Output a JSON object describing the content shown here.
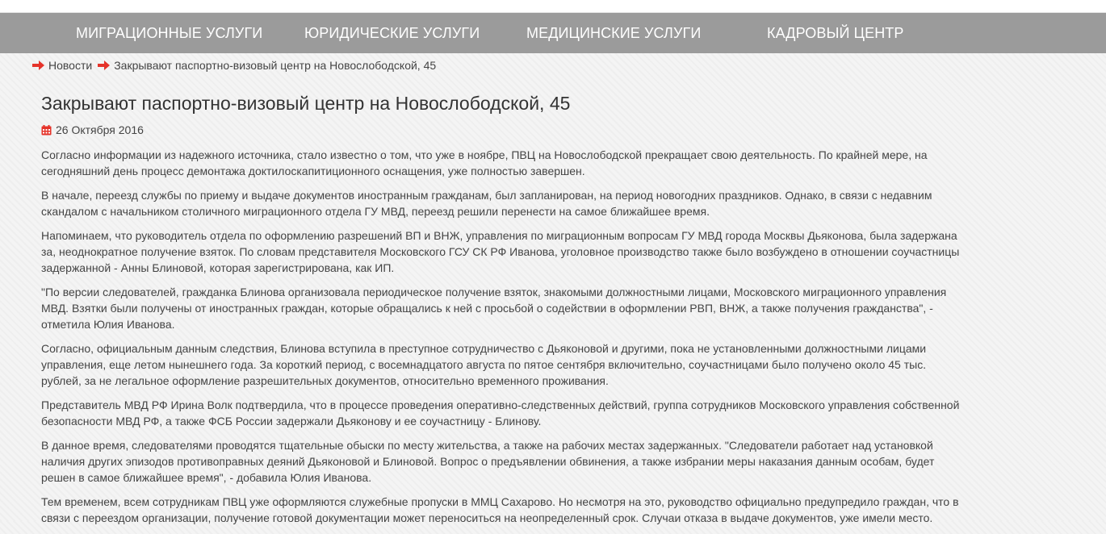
{
  "nav": {
    "items": [
      {
        "label": "МИГРАЦИОННЫЕ УСЛУГИ"
      },
      {
        "label": "ЮРИДИЧЕСКИЕ УСЛУГИ"
      },
      {
        "label": "МЕДИЦИНСКИЕ УСЛУГИ"
      },
      {
        "label": "КАДРОВЫЙ ЦЕНТР"
      }
    ]
  },
  "breadcrumb": {
    "items": [
      {
        "label": "Новости"
      },
      {
        "label": "Закрывают паспортно-визовый центр на Новослободской, 45"
      }
    ],
    "arrow_icon": "arrow-right-icon"
  },
  "article": {
    "title": "Закрывают паспортно-визовый центр на Новослободской, 45",
    "date": "26 Октября 2016",
    "date_icon": "calendar-icon",
    "paragraphs": [
      "Согласно информации из надежного источника, стало известно о том, что уже в ноябре, ПВЦ на Новослободской прекращает свою деятельность. По крайней мере, на сегодняшний день процесс демонтажа доктилоскапитиционного оснащения, уже полностью завершен.",
      "В начале, переезд службы по приему и выдаче документов иностранным гражданам, был запланирован, на период новогодних праздников. Однако, в связи с недавним скандалом с начальником столичного миграционного отдела ГУ МВД, переезд решили перенести на самое ближайшее время.",
      "Напоминаем, что руководитель отдела по оформлению разрешений ВП и ВНЖ, управления по миграционным вопросам ГУ МВД города Москвы Дьяконова, была задержана за, неоднократное получение взяток. По словам представителя Московского ГСУ СК РФ Иванова, уголовное производство также было возбуждено в отношении соучастницы задержанной - Анны Блиновой, которая зарегистрирована, как ИП.",
      "\"По версии следователей, гражданка Блинова организовала периодическое получение взяток, знакомыми должностными лицами, Московского миграционного управления МВД. Взятки были получены от иностранных граждан, которые обращались к ней с просьбой о содействии в оформлении РВП, ВНЖ, а также получения гражданства\", - отметила Юлия Иванова.",
      "Согласно, официальным данным следствия, Блинова вступила в преступное сотрудничество с Дьяконовой и другими, пока не установленными должностными лицами управления, еще летом нынешнего года. За короткий период, с восемнадцатого августа по пятое сентября включительно, соучастницами было получено около 45 тыс. рублей, за не легальное оформление разрешительных документов, относительно временного проживания.",
      "Представитель МВД РФ Ирина Волк подтвердила, что в процессе проведения оперативно-следственных действий, группа сотрудников Московского управления собственной безопасности МВД РФ, а также ФСБ России задержали Дьяконову и ее соучастницу - Блинову.",
      "В данное время, следователями проводятся тщательные обыски по месту жительства, а также на рабочих местах задержанных. \"Следователи работает над установкой наличия других эпизодов противоправных деяний Дьяконовой и Блиновой. Вопрос о предъявлении обвинения, а также избрании меры наказания данным особам, будет решен в самое ближайшее время\", - добавила Юлия Иванова.",
      "Тем временем, всем сотрудникам ПВЦ уже оформляются служебные пропуски в ММЦ Сахарово. Но несмотря на это, руководство официально предупредило граждан, что в связи с переездом организации, получение готовой документации может переноситься на неопределенный срок. Случаи отказа в выдаче документов, уже имели место."
    ]
  },
  "colors": {
    "nav_bg": "#9b9b9b",
    "nav_text": "#ffffff",
    "accent_red": "#e5332a",
    "text": "#444444"
  }
}
